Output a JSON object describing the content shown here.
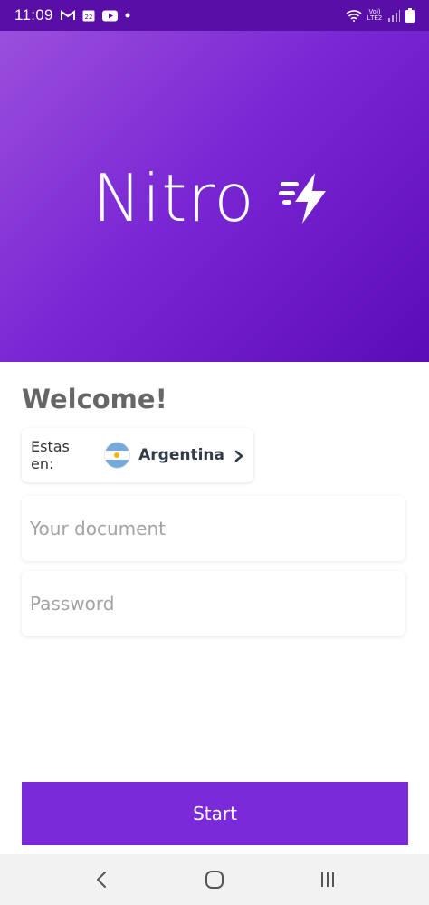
{
  "status_bar": {
    "time": "11:09",
    "network_label_top": "Vo))",
    "network_label_bottom": "LTE2",
    "icons": [
      "gmail-icon",
      "calendar-icon",
      "youtube-icon",
      "dot-icon",
      "wifi-icon",
      "signal-icon",
      "battery-icon"
    ],
    "calendar_day": "22"
  },
  "hero": {
    "brand_name": "Nitro",
    "logo_icon": "lightning-bolt-icon",
    "gradient_start": "#9b4fdc",
    "gradient_end": "#5c0bb8"
  },
  "main": {
    "welcome_title": "Welcome!",
    "country_selector": {
      "prefix": "Estas en:",
      "country": "Argentina",
      "flag_icon": "argentina-flag-icon",
      "chevron_icon": "chevron-right-icon"
    },
    "document_field": {
      "placeholder": "Your document",
      "value": ""
    },
    "password_field": {
      "placeholder": "Password",
      "value": ""
    },
    "start_button_label": "Start"
  },
  "nav_bar": {
    "items": [
      "back-icon",
      "home-icon",
      "recent-apps-icon"
    ]
  },
  "colors": {
    "accent": "#7b2ad9",
    "status_bar_bg": "#5a0ea8",
    "welcome_text": "#666666"
  }
}
